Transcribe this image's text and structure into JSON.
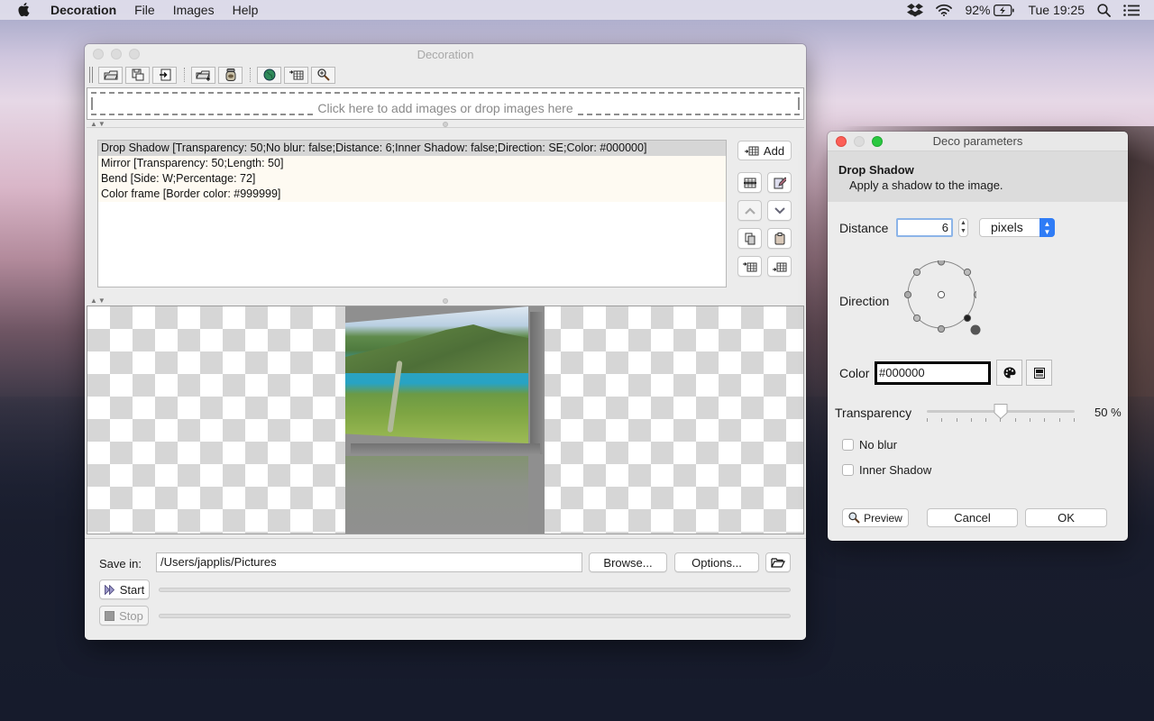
{
  "menubar": {
    "app_name": "Decoration",
    "menus": [
      "File",
      "Images",
      "Help"
    ],
    "battery": "92%",
    "clock": "Tue 19:25"
  },
  "main_window": {
    "title": "Decoration",
    "toolbar": {
      "buttons": [
        "open-icon",
        "save-icon",
        "import-icon",
        "add-folder-icon",
        "jar-icon",
        "globe-icon",
        "insert-table-icon",
        "zoom-icon"
      ]
    },
    "drop_zone_text": "Click here to add images or drop images here",
    "decorations": [
      {
        "text": "Drop Shadow [Transparency: 50;No blur: false;Distance: 6;Inner Shadow: false;Direction: SE;Color: #000000]",
        "selected": true
      },
      {
        "text": "Mirror [Transparency: 50;Length: 50]",
        "selected": false
      },
      {
        "text": "Bend [Side: W;Percentage: 72]",
        "selected": false
      },
      {
        "text": "Color frame [Border color: #999999]",
        "selected": false
      }
    ],
    "side_buttons": {
      "add_label": "Add",
      "grid": [
        "remove-icon",
        "edit-icon",
        "move-up-icon",
        "move-down-icon",
        "copy-icon",
        "paste-icon",
        "insert-before-icon",
        "insert-after-icon"
      ]
    },
    "save_in_label": "Save in:",
    "save_path": "/Users/japplis/Pictures",
    "browse_label": "Browse...",
    "options_label": "Options...",
    "start_label": "Start",
    "stop_label": "Stop",
    "progress_1": 0,
    "progress_2": 0
  },
  "dialog": {
    "title": "Deco parameters",
    "heading": "Drop Shadow",
    "description": "Apply a shadow to the image.",
    "distance_label": "Distance",
    "distance_value": "6",
    "unit": "pixels",
    "direction_label": "Direction",
    "direction_value": "SE",
    "color_label": "Color",
    "color_value": "#000000",
    "transparency_label": "Transparency",
    "transparency_value": 50,
    "transparency_text": "50 %",
    "no_blur_label": "No blur",
    "no_blur_checked": false,
    "inner_shadow_label": "Inner Shadow",
    "inner_shadow_checked": false,
    "preview_label": "Preview",
    "cancel_label": "Cancel",
    "ok_label": "OK"
  },
  "colors": {
    "selection_row": "#d6d6d6",
    "row_bg": "#fefaf2",
    "focus_ring": "#8cb4e8",
    "select_accent": "#2f7cf6",
    "close_red": "#fc5f57",
    "zoom_green": "#2ac840"
  }
}
